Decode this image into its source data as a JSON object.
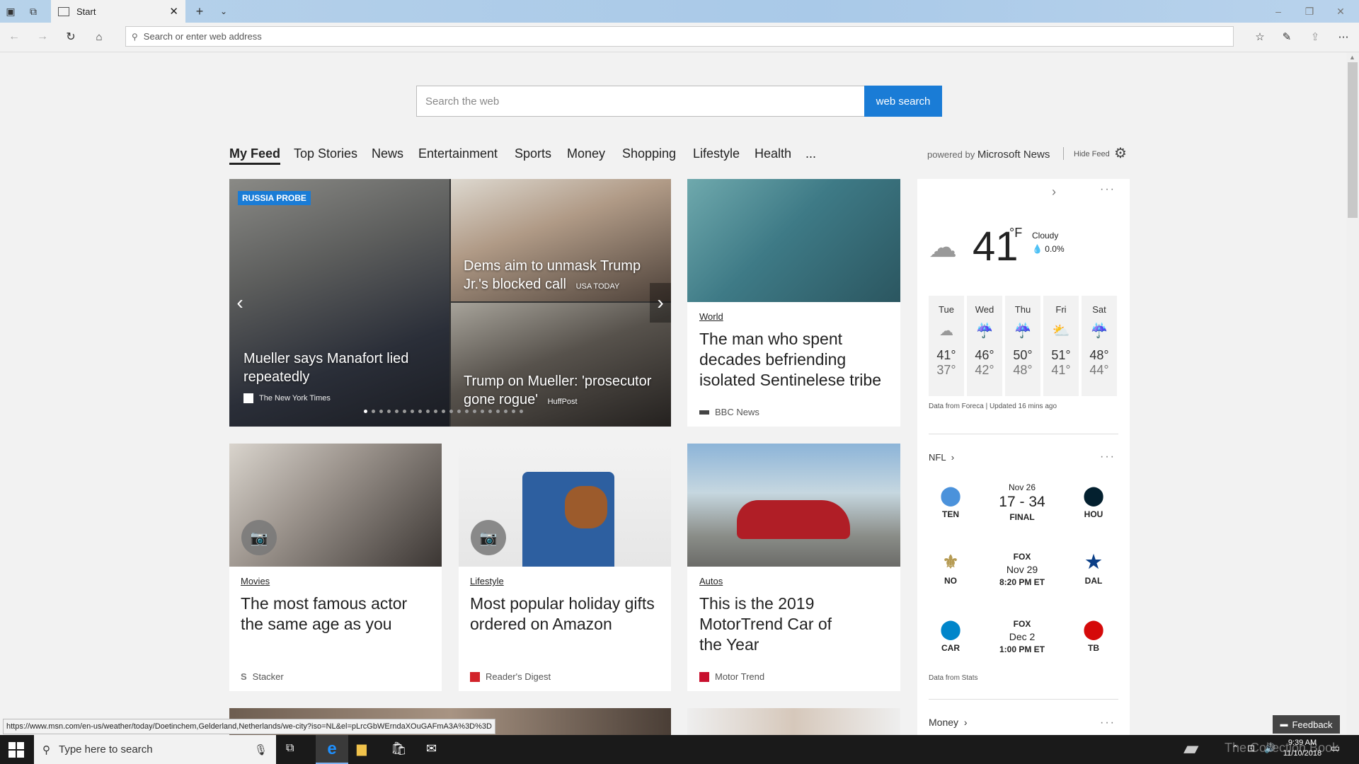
{
  "browser": {
    "tab_title": "Start",
    "address_placeholder": "Search or enter web address"
  },
  "search": {
    "placeholder": "Search the web",
    "button": "web search"
  },
  "nav": {
    "items": [
      "My Feed",
      "Top Stories",
      "News",
      "Entertainment",
      "Sports",
      "Money",
      "Shopping",
      "Lifestyle",
      "Health",
      "..."
    ],
    "powered_prefix": "powered by",
    "powered_brand": "Microsoft News",
    "hide_feed": "Hide Feed"
  },
  "hero": {
    "badge": "RUSSIA PROBE",
    "main_headline": "Mueller says Manafort lied repeatedly",
    "main_source": "The New York Times",
    "top_headline": "Dems aim to unmask Trump Jr.'s blocked call",
    "top_source": "USA TODAY",
    "bottom_headline": "Trump on Mueller: 'prosecutor gone rogue'",
    "bottom_source": "HuffPost"
  },
  "cards": [
    {
      "category": "World",
      "headline": "The man who spent decades befriending isolated Sentinelese tribe",
      "source": "BBC News"
    },
    {
      "category": "Movies",
      "headline": "The most famous actor the same age as you",
      "source": "Stacker"
    },
    {
      "category": "Lifestyle",
      "headline": "Most popular holiday gifts ordered on Amazon",
      "source": "Reader's Digest"
    },
    {
      "category": "Autos",
      "headline": "This is the 2019 MotorTrend Car of the Year",
      "source": "Motor Trend"
    }
  ],
  "weather": {
    "temp": "41",
    "unit": "°F",
    "condition": "Cloudy",
    "precip": "0.0%",
    "days": [
      {
        "day": "Tue",
        "high": "41°",
        "low": "37°",
        "icon": "cloud-icon"
      },
      {
        "day": "Wed",
        "high": "46°",
        "low": "42°",
        "icon": "rain-icon"
      },
      {
        "day": "Thu",
        "high": "50°",
        "low": "48°",
        "icon": "rain-icon"
      },
      {
        "day": "Fri",
        "high": "51°",
        "low": "41°",
        "icon": "partly-sunny-icon"
      },
      {
        "day": "Sat",
        "high": "48°",
        "low": "44°",
        "icon": "rain-icon"
      }
    ],
    "footer": "Data from Foreca | Updated 16 mins ago"
  },
  "nfl": {
    "title": "NFL",
    "games": [
      {
        "home": "TEN",
        "away": "HOU",
        "line1": "Nov 26",
        "line2": "17 - 34",
        "line3": "FINAL"
      },
      {
        "home": "NO",
        "away": "DAL",
        "line1": "FOX",
        "line2": "Nov 29",
        "line3": "8:20 PM ET"
      },
      {
        "home": "CAR",
        "away": "TB",
        "line1": "FOX",
        "line2": "Dec 2",
        "line3": "1:00 PM ET"
      }
    ],
    "footer": "Data from Stats"
  },
  "money": {
    "title": "Money"
  },
  "feedback": "Feedback",
  "status_url": "https://www.msn.com/en-us/weather/today/Doetinchem,Gelderland,Netherlands/we-city?iso=NL&el=pLrcGbWErndaXOuGAFmA3A%3D%3D",
  "taskbar": {
    "search_placeholder": "Type here to search",
    "time": "9:39 AM",
    "date": "11/10/2018",
    "watermark": "The Collection Book"
  }
}
